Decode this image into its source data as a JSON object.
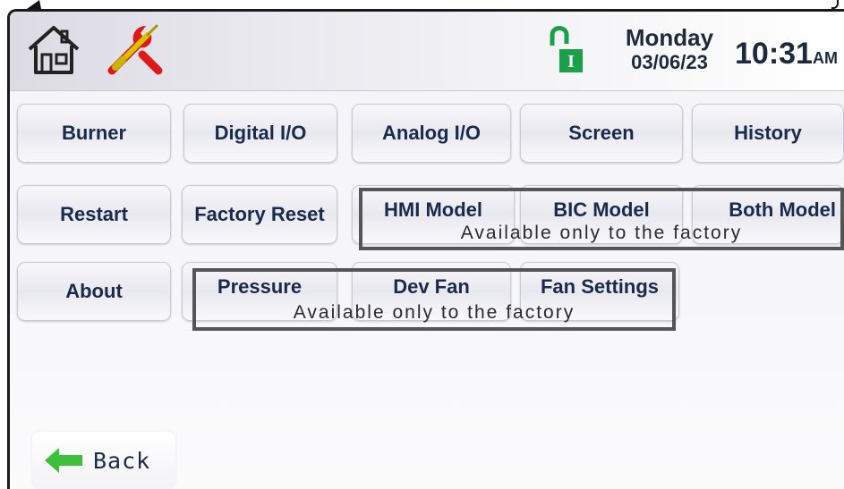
{
  "header": {
    "day": "Monday",
    "date": "03/06/23",
    "time": "10:31",
    "ampm": "AM",
    "lock_icon_letter": "I",
    "lock_color": "#1aa048"
  },
  "menu": {
    "row1": [
      "Burner",
      "Digital I/O",
      "Analog I/O",
      "Screen",
      "History"
    ],
    "row2": [
      "Restart",
      "Factory Reset",
      "HMI Model",
      "BIC Model",
      "Both Model"
    ],
    "row3": [
      "About",
      "Pressure",
      "Dev Fan",
      "Fan Settings"
    ]
  },
  "notes": {
    "factory_row2": "Available only to the factory",
    "factory_row3": "Available only to the factory"
  },
  "footer": {
    "back_label": "Back",
    "back_arrow_color": "#3cc03c"
  },
  "colors": {
    "button_text": "#1a2a4a",
    "factory_box_border": "#555555"
  }
}
